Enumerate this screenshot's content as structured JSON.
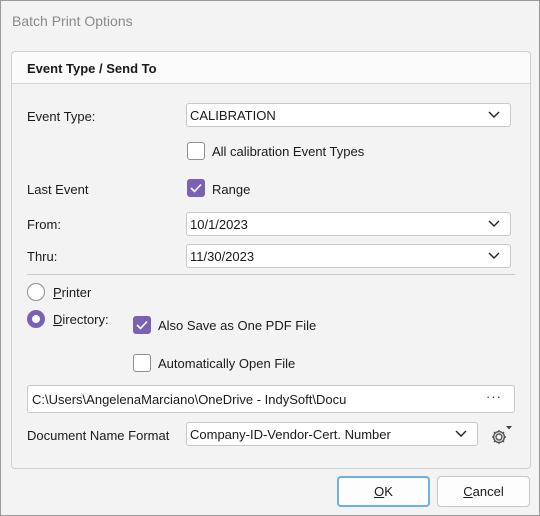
{
  "window": {
    "title": "Batch Print Options"
  },
  "group": {
    "title": "Event Type / Send To"
  },
  "event_type": {
    "label": "Event Type:",
    "value": "CALIBRATION"
  },
  "all_event_types": {
    "label": "All calibration Event Types",
    "checked": false
  },
  "last_event": {
    "label": "Last Event"
  },
  "range": {
    "label": "Range",
    "checked": true
  },
  "from": {
    "label": "From:",
    "value": "10/1/2023"
  },
  "thru": {
    "label": "Thru:",
    "value": "11/30/2023"
  },
  "printer": {
    "mnemonic": "P",
    "rest": "rinter",
    "selected": false
  },
  "directory": {
    "mnemonic": "D",
    "rest": "irectory:",
    "selected": true
  },
  "save_pdf": {
    "label": "Also Save as One PDF File",
    "checked": true
  },
  "auto_open": {
    "label": "Automatically Open File",
    "checked": false
  },
  "path": {
    "value": "C:\\Users\\AngelenaMarciano\\OneDrive - IndySoft\\Docu",
    "browse": "···"
  },
  "doc_name_format": {
    "label": "Document Name Format",
    "value": "Company-ID-Vendor-Cert. Number"
  },
  "buttons": {
    "ok": {
      "mnemonic": "O",
      "rest": "K"
    },
    "cancel": {
      "mnemonic": "C",
      "rest": "ancel"
    }
  },
  "colors": {
    "accent": "#7b61b3",
    "default_button_border": "#6fb1e4"
  },
  "icons": {
    "dropdown": "chevron-down-icon",
    "check": "check-icon",
    "settings": "gear-icon"
  }
}
